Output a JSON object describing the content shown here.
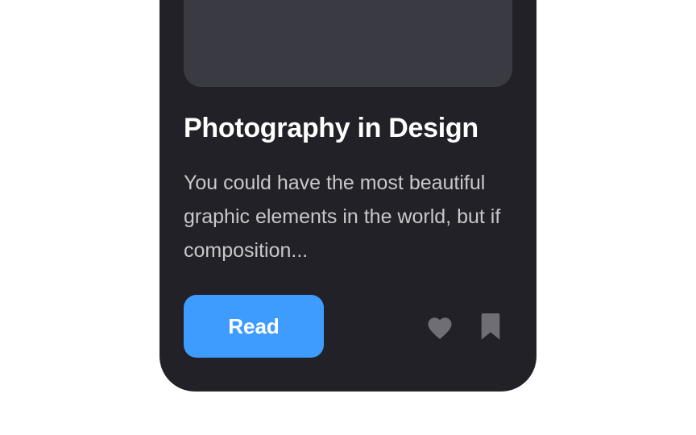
{
  "card": {
    "title": "Photography in Design",
    "description": "You could have the most beautiful graphic elements in the world, but if composition...",
    "read_label": "Read",
    "icons": {
      "like": "heart-icon",
      "save": "bookmark-icon"
    }
  },
  "colors": {
    "card_background": "#212127",
    "image_placeholder": "#3a3a42",
    "accent": "#3f9cff",
    "icon": "#6e6e74"
  }
}
